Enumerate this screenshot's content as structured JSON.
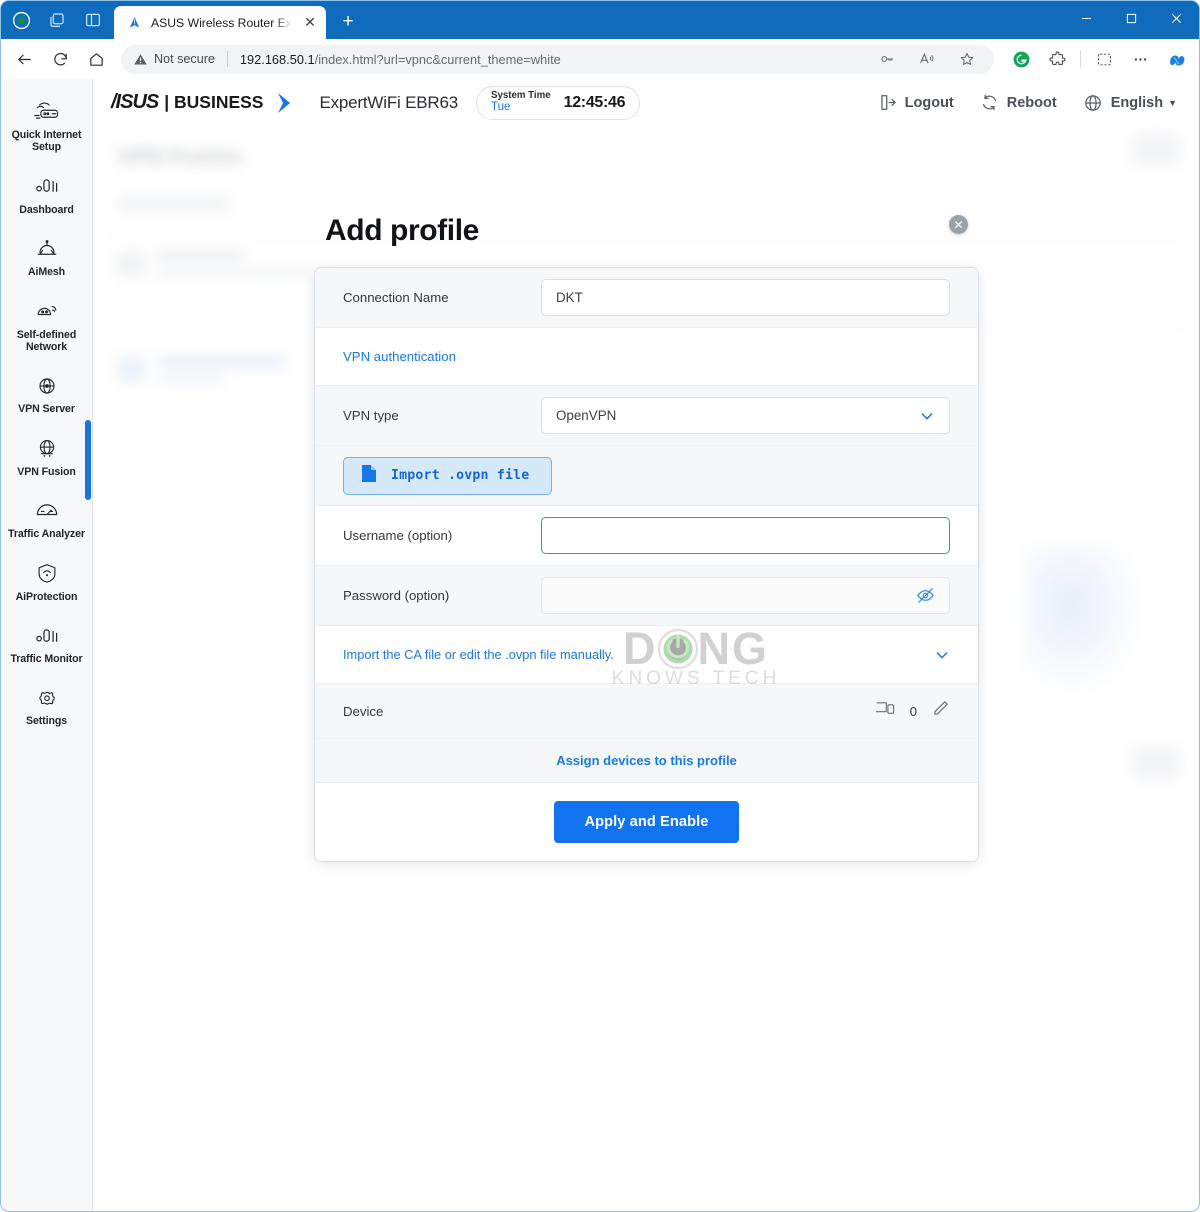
{
  "browser": {
    "tab": {
      "title": "ASUS Wireless Router ExpertWiFi",
      "favicon": "asus-logo-icon",
      "close_label": "✕",
      "new_tab_label": "+"
    },
    "window_controls": {
      "minimize": "—",
      "maximize": "□",
      "close": "✕"
    },
    "address": {
      "security_text": "Not secure",
      "url_host": "192.168.50.1",
      "url_path": "/index.html?url=vpnc&current_theme=white"
    },
    "toolbar_icons": [
      "password-key-icon",
      "read-aloud-icon",
      "favorite-star-icon",
      "grammarly-icon",
      "extensions-icon",
      "screenshot-icon",
      "settings-ellipsis-icon",
      "copilot-icon"
    ],
    "nav_icons": [
      "back-icon",
      "refresh-icon",
      "home-icon"
    ]
  },
  "sidebar": {
    "items": [
      {
        "label": "Quick Internet Setup",
        "icon": "quick-internet-setup-icon"
      },
      {
        "label": "Dashboard",
        "icon": "dashboard-bars-icon"
      },
      {
        "label": "AiMesh",
        "icon": "aimesh-icon"
      },
      {
        "label": "Self-defined Network",
        "icon": "self-defined-network-icon"
      },
      {
        "label": "VPN Server",
        "icon": "vpn-server-icon"
      },
      {
        "label": "VPN Fusion",
        "icon": "vpn-fusion-icon"
      },
      {
        "label": "Traffic Analyzer",
        "icon": "traffic-analyzer-icon"
      },
      {
        "label": "AiProtection",
        "icon": "aiprotection-shield-icon"
      },
      {
        "label": "Traffic Monitor",
        "icon": "traffic-monitor-bars-icon"
      },
      {
        "label": "Settings",
        "icon": "settings-gear-icon"
      }
    ],
    "active": "VPN Fusion"
  },
  "header": {
    "brand": "/ISUS",
    "brand_suffix": "| BUSINESS",
    "model": "ExpertWiFi EBR63",
    "system_time_label": "System Time",
    "system_time_day": "Tue",
    "system_time_clock": "12:45:46",
    "logout": "Logout",
    "reboot": "Reboot",
    "language": "English"
  },
  "backdrop": {
    "page_title": "VPN Fusion"
  },
  "modal": {
    "title": "Add profile",
    "close_label": "✕",
    "rows": {
      "connection_name_label": "Connection Name",
      "connection_name_value": "DKT",
      "vpn_authentication_link": "VPN authentication",
      "vpn_type_label": "VPN type",
      "vpn_type_value": "OpenVPN",
      "import_button_label": "Import .ovpn file",
      "username_label": "Username (option)",
      "username_value": "",
      "password_label": "Password (option)",
      "password_value": "",
      "ca_file_link": "Import the CA file or edit the .ovpn file manually.",
      "device_label": "Device",
      "device_count": "0",
      "assign_link": "Assign devices to this profile",
      "apply_button_label": "Apply and Enable"
    }
  },
  "watermark": {
    "line1_left": "D",
    "line1_right": "NG",
    "line2": "KNOWS TECH"
  },
  "colors": {
    "browser_chrome": "#0f6cbd",
    "accent_blue": "#1173ef",
    "link_blue": "#1a7ae0",
    "row_alt": "#f5f7f9",
    "import_btn_bg": "#d6e9fb"
  }
}
